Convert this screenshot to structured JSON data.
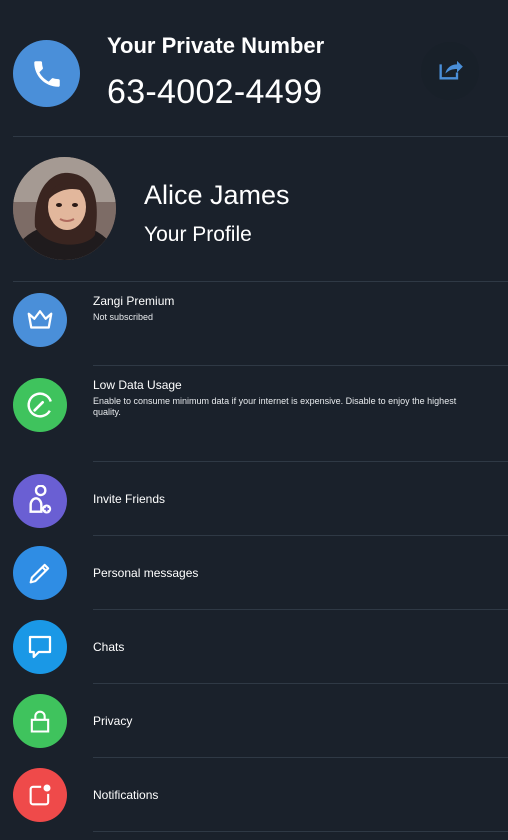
{
  "private_number": {
    "title": "Your Private Number",
    "number": "63-4002-4499",
    "icon": "phone-icon",
    "share_icon": "share-icon",
    "accent": "#4a8fd9"
  },
  "profile": {
    "name": "Alice James",
    "subtitle": "Your Profile"
  },
  "menu": {
    "premium": {
      "title": "Zangi Premium",
      "subtitle": "Not subscribed",
      "icon": "crown-icon",
      "color": "#4a8fd9"
    },
    "low_data": {
      "title": "Low Data Usage",
      "subtitle": "Enable to consume minimum data if your internet is expensive. Disable to enjoy the highest quality.",
      "icon": "speedometer-icon",
      "color": "#3fc35d"
    },
    "invite": {
      "title": "Invite Friends",
      "icon": "add-person-icon",
      "color": "#6a5fd3"
    },
    "personal_messages": {
      "title": "Personal messages",
      "icon": "pencil-icon",
      "color": "#2f8de4"
    },
    "chats": {
      "title": "Chats",
      "icon": "chat-bubble-icon",
      "color": "#1a98e6"
    },
    "privacy": {
      "title": "Privacy",
      "icon": "lock-icon",
      "color": "#3fc35d"
    },
    "notifications": {
      "title": "Notifications",
      "icon": "notification-icon",
      "color": "#ef4a4a"
    }
  }
}
